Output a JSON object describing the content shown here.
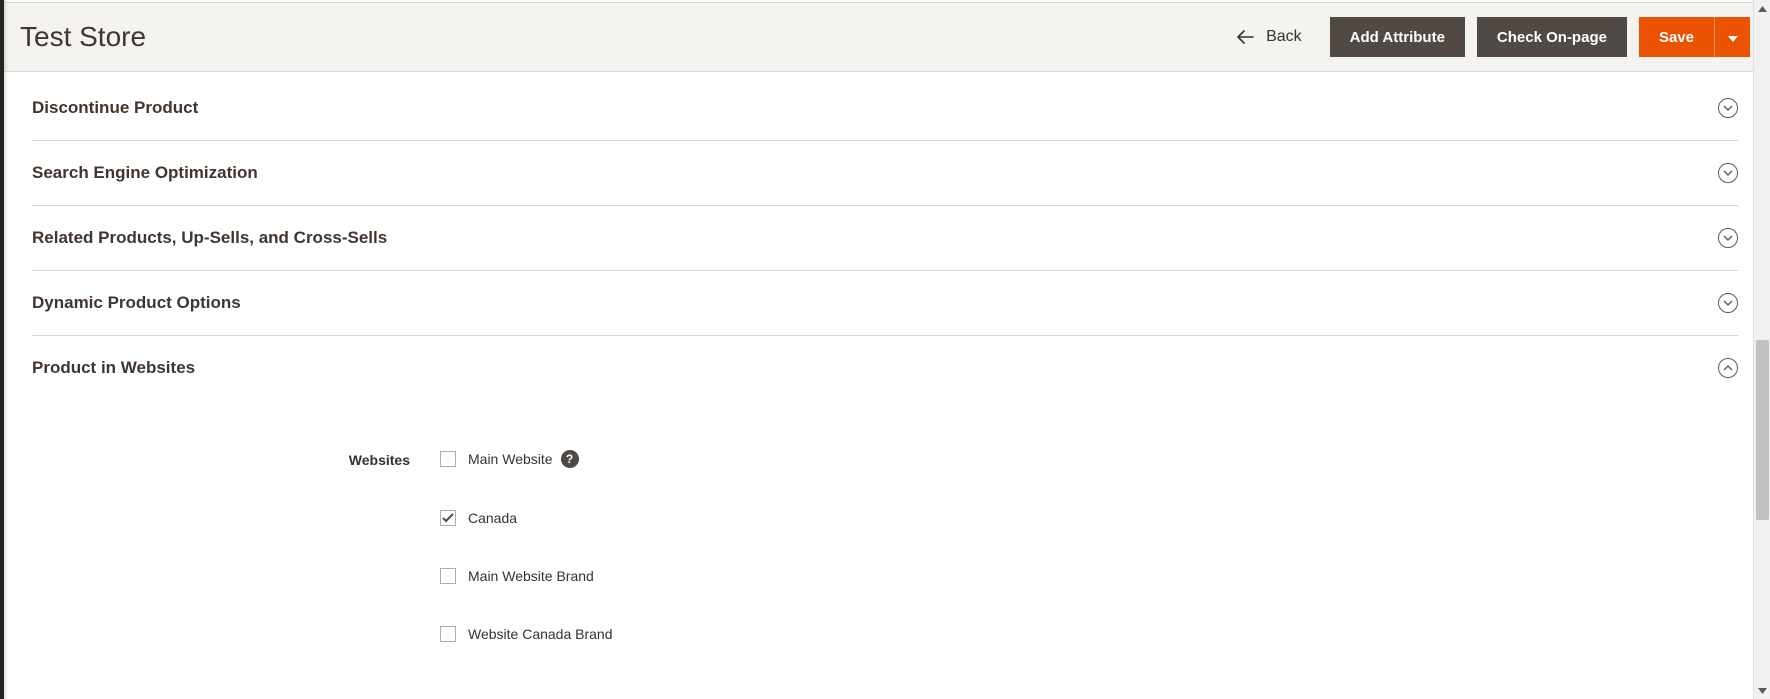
{
  "header": {
    "title": "Test Store",
    "back_label": "Back",
    "add_attribute_label": "Add Attribute",
    "check_onpage_label": "Check On-page",
    "save_label": "Save"
  },
  "sections": {
    "discontinue": {
      "title": "Discontinue Product",
      "expanded": false
    },
    "seo": {
      "title": "Search Engine Optimization",
      "expanded": false
    },
    "related": {
      "title": "Related Products, Up-Sells, and Cross-Sells",
      "expanded": false
    },
    "dynamic": {
      "title": "Dynamic Product Options",
      "expanded": false
    },
    "websites": {
      "title": "Product in Websites",
      "expanded": true
    }
  },
  "websites_field": {
    "label": "Websites",
    "items": [
      {
        "label": "Main Website",
        "checked": false,
        "has_help": true
      },
      {
        "label": "Canada",
        "checked": true,
        "has_help": false
      },
      {
        "label": "Main Website Brand",
        "checked": false,
        "has_help": false
      },
      {
        "label": "Website Canada Brand",
        "checked": false,
        "has_help": false
      }
    ]
  }
}
